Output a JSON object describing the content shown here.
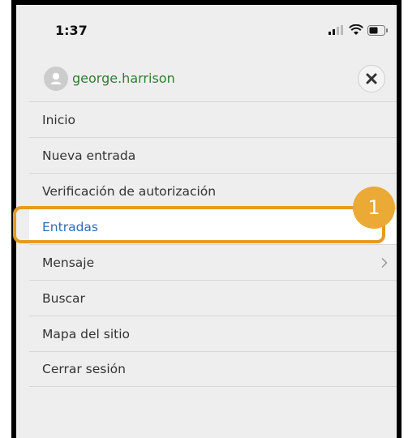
{
  "status_bar": {
    "time": "1:37",
    "icons": [
      "signal-icon",
      "wifi-icon",
      "battery-icon"
    ]
  },
  "header": {
    "username": "george.harrison",
    "avatar_icon": "user-avatar-icon",
    "close_icon": "close-icon"
  },
  "menu": {
    "items": [
      {
        "label": "Inicio"
      },
      {
        "label": "Nueva entrada"
      },
      {
        "label": "Verificación de autorización"
      },
      {
        "label": "Entradas",
        "active": true
      },
      {
        "label": "Mensaje",
        "has_submenu": true
      },
      {
        "label": "Buscar"
      },
      {
        "label": "Mapa del sitio"
      },
      {
        "label": "Cerrar sesión"
      }
    ]
  },
  "annotation": {
    "step_number": "1",
    "color": "#e69b22"
  },
  "colors": {
    "username": "#2e7d32",
    "active_item": "#2f6db5",
    "highlight": "#e69b22"
  }
}
